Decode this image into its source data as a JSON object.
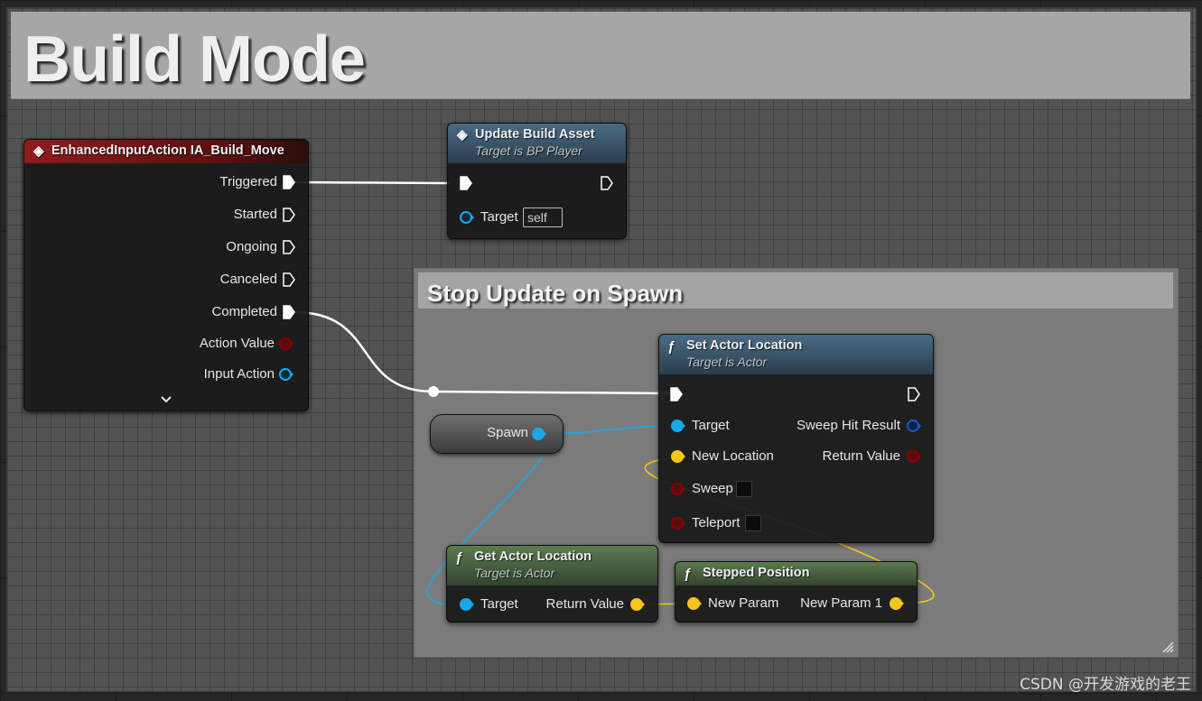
{
  "comment": {
    "title": "Build Mode"
  },
  "inner_comment": {
    "title": "Stop Update on Spawn"
  },
  "input_node": {
    "title": "EnhancedInputAction IA_Build_Move",
    "pins": [
      "Triggered",
      "Started",
      "Ongoing",
      "Canceled",
      "Completed",
      "Action Value",
      "Input Action"
    ],
    "expand_icon": "chevron-down-icon"
  },
  "update_node": {
    "title": "Update Build Asset",
    "subtitle": "Target is BP Player",
    "target_label": "Target",
    "target_value": "self"
  },
  "set_node": {
    "title": "Set Actor Location",
    "subtitle": "Target is Actor",
    "inputs": [
      "Target",
      "New Location",
      "Sweep",
      "Teleport"
    ],
    "outputs": [
      "Sweep Hit Result",
      "Return Value"
    ]
  },
  "spawn_node": {
    "label": "Spawn"
  },
  "get_node": {
    "title": "Get Actor Location",
    "subtitle": "Target is Actor",
    "input": "Target",
    "output": "Return Value"
  },
  "stepped_node": {
    "title": "Stepped Position",
    "input": "New Param",
    "output": "New Param 1"
  },
  "watermark": "CSDN @开发游戏的老王",
  "colors": {
    "event_header": "#8f1c1c",
    "call_header": "#3f5f7a",
    "pure_header": "#4d6b44",
    "exec_wire": "#ffffff",
    "object_wire": "#1aa7e6",
    "vector_wire": "#f5c518",
    "bool_pin": "#8b0000"
  }
}
